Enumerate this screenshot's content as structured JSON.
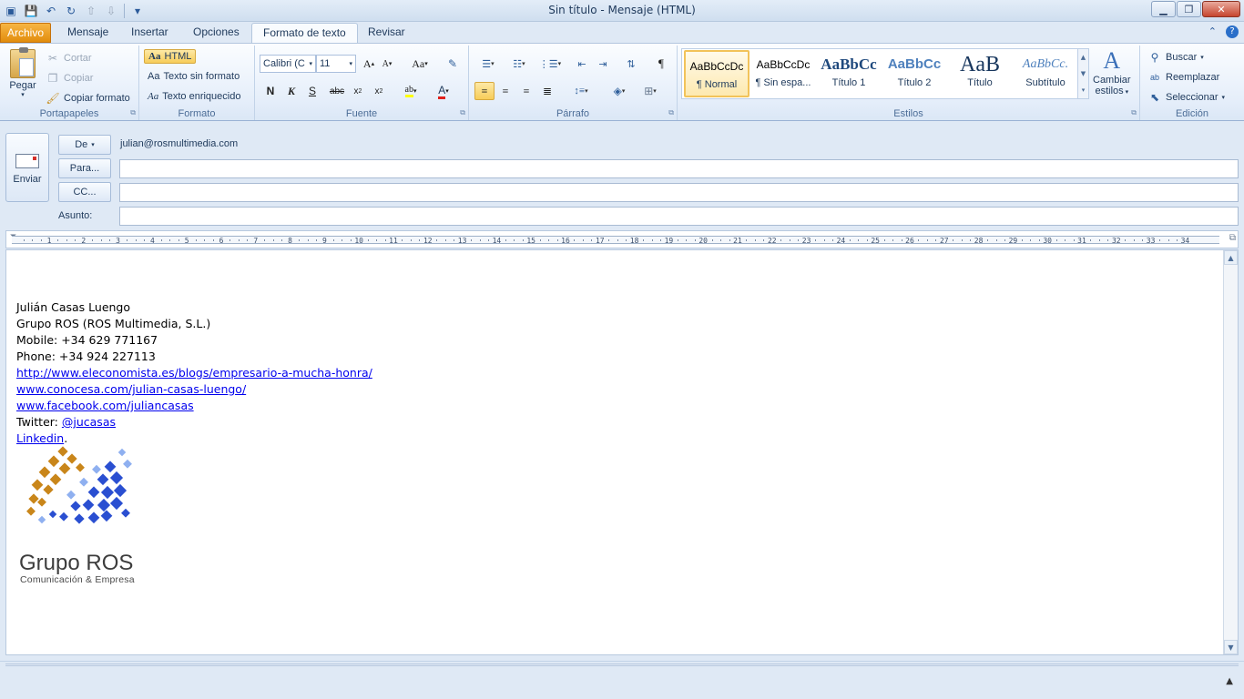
{
  "window": {
    "title": "Sin título  -  Mensaje (HTML)",
    "minimize_icon": "minimize-icon",
    "maximize_icon": "restore-icon",
    "close_icon": "close-icon"
  },
  "quick_access": [
    "save-icon",
    "undo-icon",
    "redo-icon",
    "up-icon",
    "down-icon",
    "customize-icon"
  ],
  "tabs": [
    {
      "label": "Archivo"
    },
    {
      "label": "Mensaje"
    },
    {
      "label": "Insertar"
    },
    {
      "label": "Opciones"
    },
    {
      "label": "Formato de texto"
    },
    {
      "label": "Revisar"
    }
  ],
  "ribbon": {
    "clipboard": {
      "label": "Portapapeles",
      "paste": "Pegar",
      "cut": "Cortar",
      "copy": "Copiar",
      "format_painter": "Copiar formato"
    },
    "format": {
      "label": "Formato",
      "html": "HTML",
      "plain": "Texto sin formato",
      "rich": "Texto enriquecido",
      "aa": "Aa"
    },
    "font": {
      "label": "Fuente",
      "font_name": "Calibri (C",
      "font_size": "11"
    },
    "paragraph": {
      "label": "Párrafo"
    },
    "styles": {
      "label": "Estilos",
      "items": [
        {
          "sample": "AaBbCcDc",
          "name": "¶ Normal"
        },
        {
          "sample": "AaBbCcDc",
          "name": "¶ Sin espa..."
        },
        {
          "sample": "AaBbCc",
          "name": "Título 1"
        },
        {
          "sample": "AaBbCc",
          "name": "Título 2"
        },
        {
          "sample": "AaB",
          "name": "Título"
        },
        {
          "sample": "AaBbCc.",
          "name": "Subtítulo"
        }
      ],
      "change_styles_line1": "Cambiar",
      "change_styles_line2": "estilos"
    },
    "editing": {
      "label": "Edición",
      "find": "Buscar",
      "replace": "Reemplazar",
      "select": "Seleccionar"
    }
  },
  "header": {
    "send": "Enviar",
    "from_button": "De",
    "from_value": "julian@rosmultimedia.com",
    "to_button": "Para...",
    "cc_button": "CC...",
    "subject_label": "Asunto:",
    "to_value": "",
    "cc_value": "",
    "subject_value": ""
  },
  "ruler": {
    "numbers": [
      "1",
      "2",
      "3",
      "4",
      "5",
      "6",
      "7",
      "8",
      "9",
      "10",
      "11",
      "12",
      "13",
      "14",
      "15",
      "16",
      "17",
      "18",
      "19",
      "20",
      "21",
      "22",
      "23",
      "24",
      "25",
      "26",
      "27",
      "28",
      "29",
      "30",
      "31",
      "32",
      "33",
      "34"
    ]
  },
  "body": {
    "name": "Julián Casas Luengo",
    "company": "Grupo ROS (ROS Multimedia, S.L.)",
    "mobile": "Mobile: +34 629 771167",
    "phone": "Phone: +34 924 227113",
    "link1": "http://www.eleconomista.es/blogs/empresario-a-mucha-honra/",
    "link2": "www.conocesa.com/julian-casas-luengo/",
    "link3": "www.facebook.com/juliancasas",
    "twitter_prefix": "Twitter: ",
    "twitter_handle": "@jucasas",
    "linkedin": "Linkedin",
    "linkedin_suffix": ".",
    "logo_title": "Grupo ROS",
    "logo_subtitle": "Comunicación & Empresa"
  },
  "colors": {
    "file_tab": "#e28d0d",
    "link": "#0000ee",
    "logo_orange": "#c9861a",
    "logo_blue": "#2a4fd1"
  }
}
